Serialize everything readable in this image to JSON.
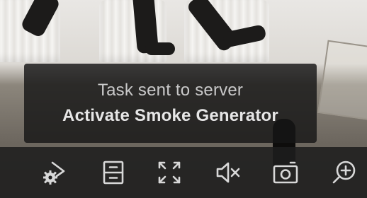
{
  "toast": {
    "line1": "Task sent to server",
    "line2": "Activate Smoke Generator"
  },
  "toolbar": {
    "buttons": [
      {
        "icon": "gear-play-icon"
      },
      {
        "icon": "archive-icon"
      },
      {
        "icon": "fullscreen-icon"
      },
      {
        "icon": "mute-icon"
      },
      {
        "icon": "camera-snapshot-icon"
      },
      {
        "icon": "zoom-in-icon"
      }
    ]
  },
  "colors": {
    "toolbar_bg": "#1e1e1e",
    "toast_bg": "#161616",
    "icon": "#d8d8d8"
  }
}
